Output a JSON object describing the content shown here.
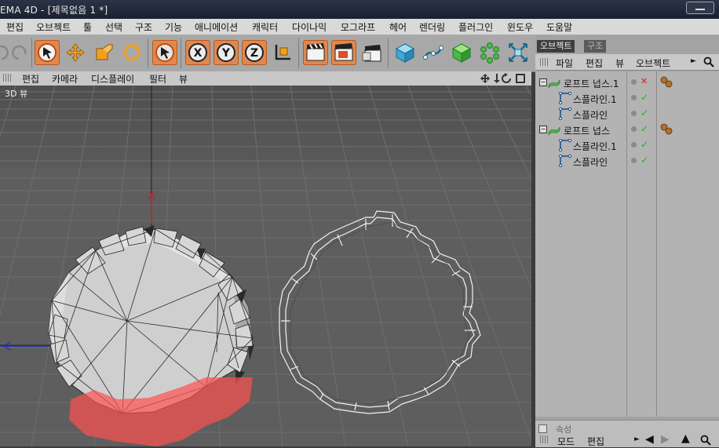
{
  "window": {
    "title": "EMA 4D - [제목없음 1 *]"
  },
  "menu": {
    "items": [
      "편집",
      "오브젝트",
      "툴",
      "선택",
      "구조",
      "기능",
      "애니메이션",
      "캐릭터",
      "다이나믹",
      "모그라프",
      "헤어",
      "렌더링",
      "플러그인",
      "윈도우",
      "도움말"
    ]
  },
  "toolbar": {
    "axis_x": "X",
    "axis_y": "Y",
    "axis_z": "Z"
  },
  "viewport": {
    "menu": [
      "편집",
      "카메라",
      "디스플레이",
      "필터",
      "뷰"
    ],
    "label": "3D 뷰",
    "axis_y": "Y"
  },
  "panel": {
    "tabs": [
      "오브젝트",
      "구조"
    ],
    "menu": [
      "파일",
      "편집",
      "뷰",
      "오브젝트"
    ],
    "objects": [
      {
        "name": "로프트 넙스.1",
        "level": 0,
        "status": "disabled"
      },
      {
        "name": "스플라인.1",
        "level": 1,
        "status": "enabled"
      },
      {
        "name": "스플라인",
        "level": 1,
        "status": "enabled"
      },
      {
        "name": "로프트 넙스",
        "level": 0,
        "status": "enabled"
      },
      {
        "name": "스플라인.1",
        "level": 1,
        "status": "enabled"
      },
      {
        "name": "스플라인",
        "level": 1,
        "status": "enabled"
      }
    ],
    "attr_title": "속성",
    "attr_menu": [
      "모드",
      "편집"
    ]
  },
  "colors": {
    "accent": "#e0884d",
    "check": "#2ea82e",
    "cross": "#d42020",
    "viewport": "#5c5c5c"
  }
}
